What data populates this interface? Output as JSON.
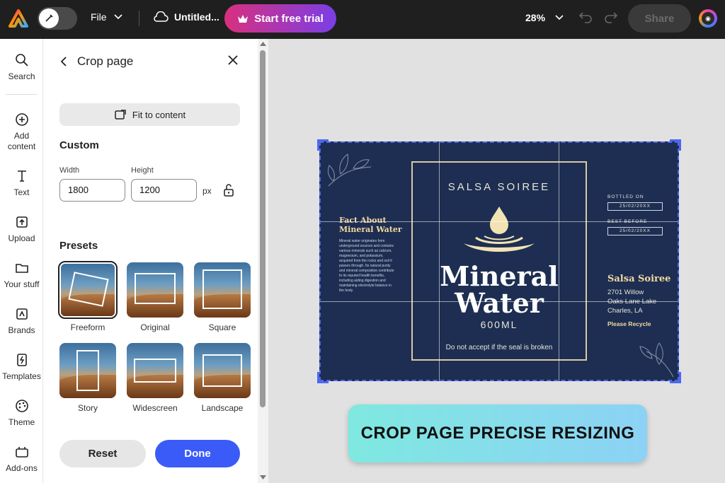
{
  "topbar": {
    "file_label": "File",
    "doc_title": "Untitled...",
    "trial_label": "Start free trial",
    "zoom_label": "28%",
    "share_label": "Share"
  },
  "rail": {
    "items": [
      {
        "label": "Search",
        "icon": "search-icon"
      },
      {
        "label": "Add\ncontent",
        "icon": "plus-circle-icon"
      },
      {
        "label": "Text",
        "icon": "text-icon"
      },
      {
        "label": "Upload",
        "icon": "upload-icon"
      },
      {
        "label": "Your stuff",
        "icon": "folder-icon"
      },
      {
        "label": "Brands",
        "icon": "brands-icon"
      },
      {
        "label": "Templates",
        "icon": "templates-icon"
      },
      {
        "label": "Theme",
        "icon": "palette-icon"
      },
      {
        "label": "Add-ons",
        "icon": "addons-icon"
      }
    ]
  },
  "panel": {
    "title": "Crop page",
    "fit_label": "Fit to content",
    "custom_title": "Custom",
    "width_label": "Width",
    "width_value": "1800",
    "height_label": "Height",
    "height_value": "1200",
    "unit": "px",
    "presets_title": "Presets",
    "presets": [
      {
        "label": "Freeform",
        "selected": true
      },
      {
        "label": "Original",
        "selected": false
      },
      {
        "label": "Square",
        "selected": false
      },
      {
        "label": "Story",
        "selected": false
      },
      {
        "label": "Widescreen",
        "selected": false
      },
      {
        "label": "Landscape",
        "selected": false
      }
    ],
    "reset_label": "Reset",
    "done_label": "Done"
  },
  "canvas": {
    "brand_top": "SALSA SOIREE",
    "title_line1": "Mineral",
    "title_line2": "Water",
    "volume": "600ML",
    "seal_note": "Do not accept if the seal is broken",
    "fact_title_line1": "Fact About",
    "fact_title_line2": "Mineral Water",
    "fact_body": "Mineral water originates from underground sources and contains various minerals such as calcium, magnesium, and potassium, acquired from the rocks and soil it passes through. Its natural purity and mineral composition contribute to its reputed health benefits, including aiding digestion and maintaining electrolyte balance in the body.",
    "bottled_label": "BOTTLED ON",
    "bottled_date": "25/02/20XX",
    "best_label": "BEST BEFORE",
    "best_date": "25/02/20XX",
    "addr_title": "Salsa Soiree",
    "addr_line1": "2701 Willow",
    "addr_line2": "Oaks Lane Lake",
    "addr_line3": "Charles, LA",
    "recycle": "Please Recycle"
  },
  "banner": {
    "text": "CROP PAGE PRECISE RESIZING"
  },
  "colors": {
    "accent": "#3a5bf7",
    "label_bg": "#1d2e52",
    "selection": "#4e67f0"
  }
}
